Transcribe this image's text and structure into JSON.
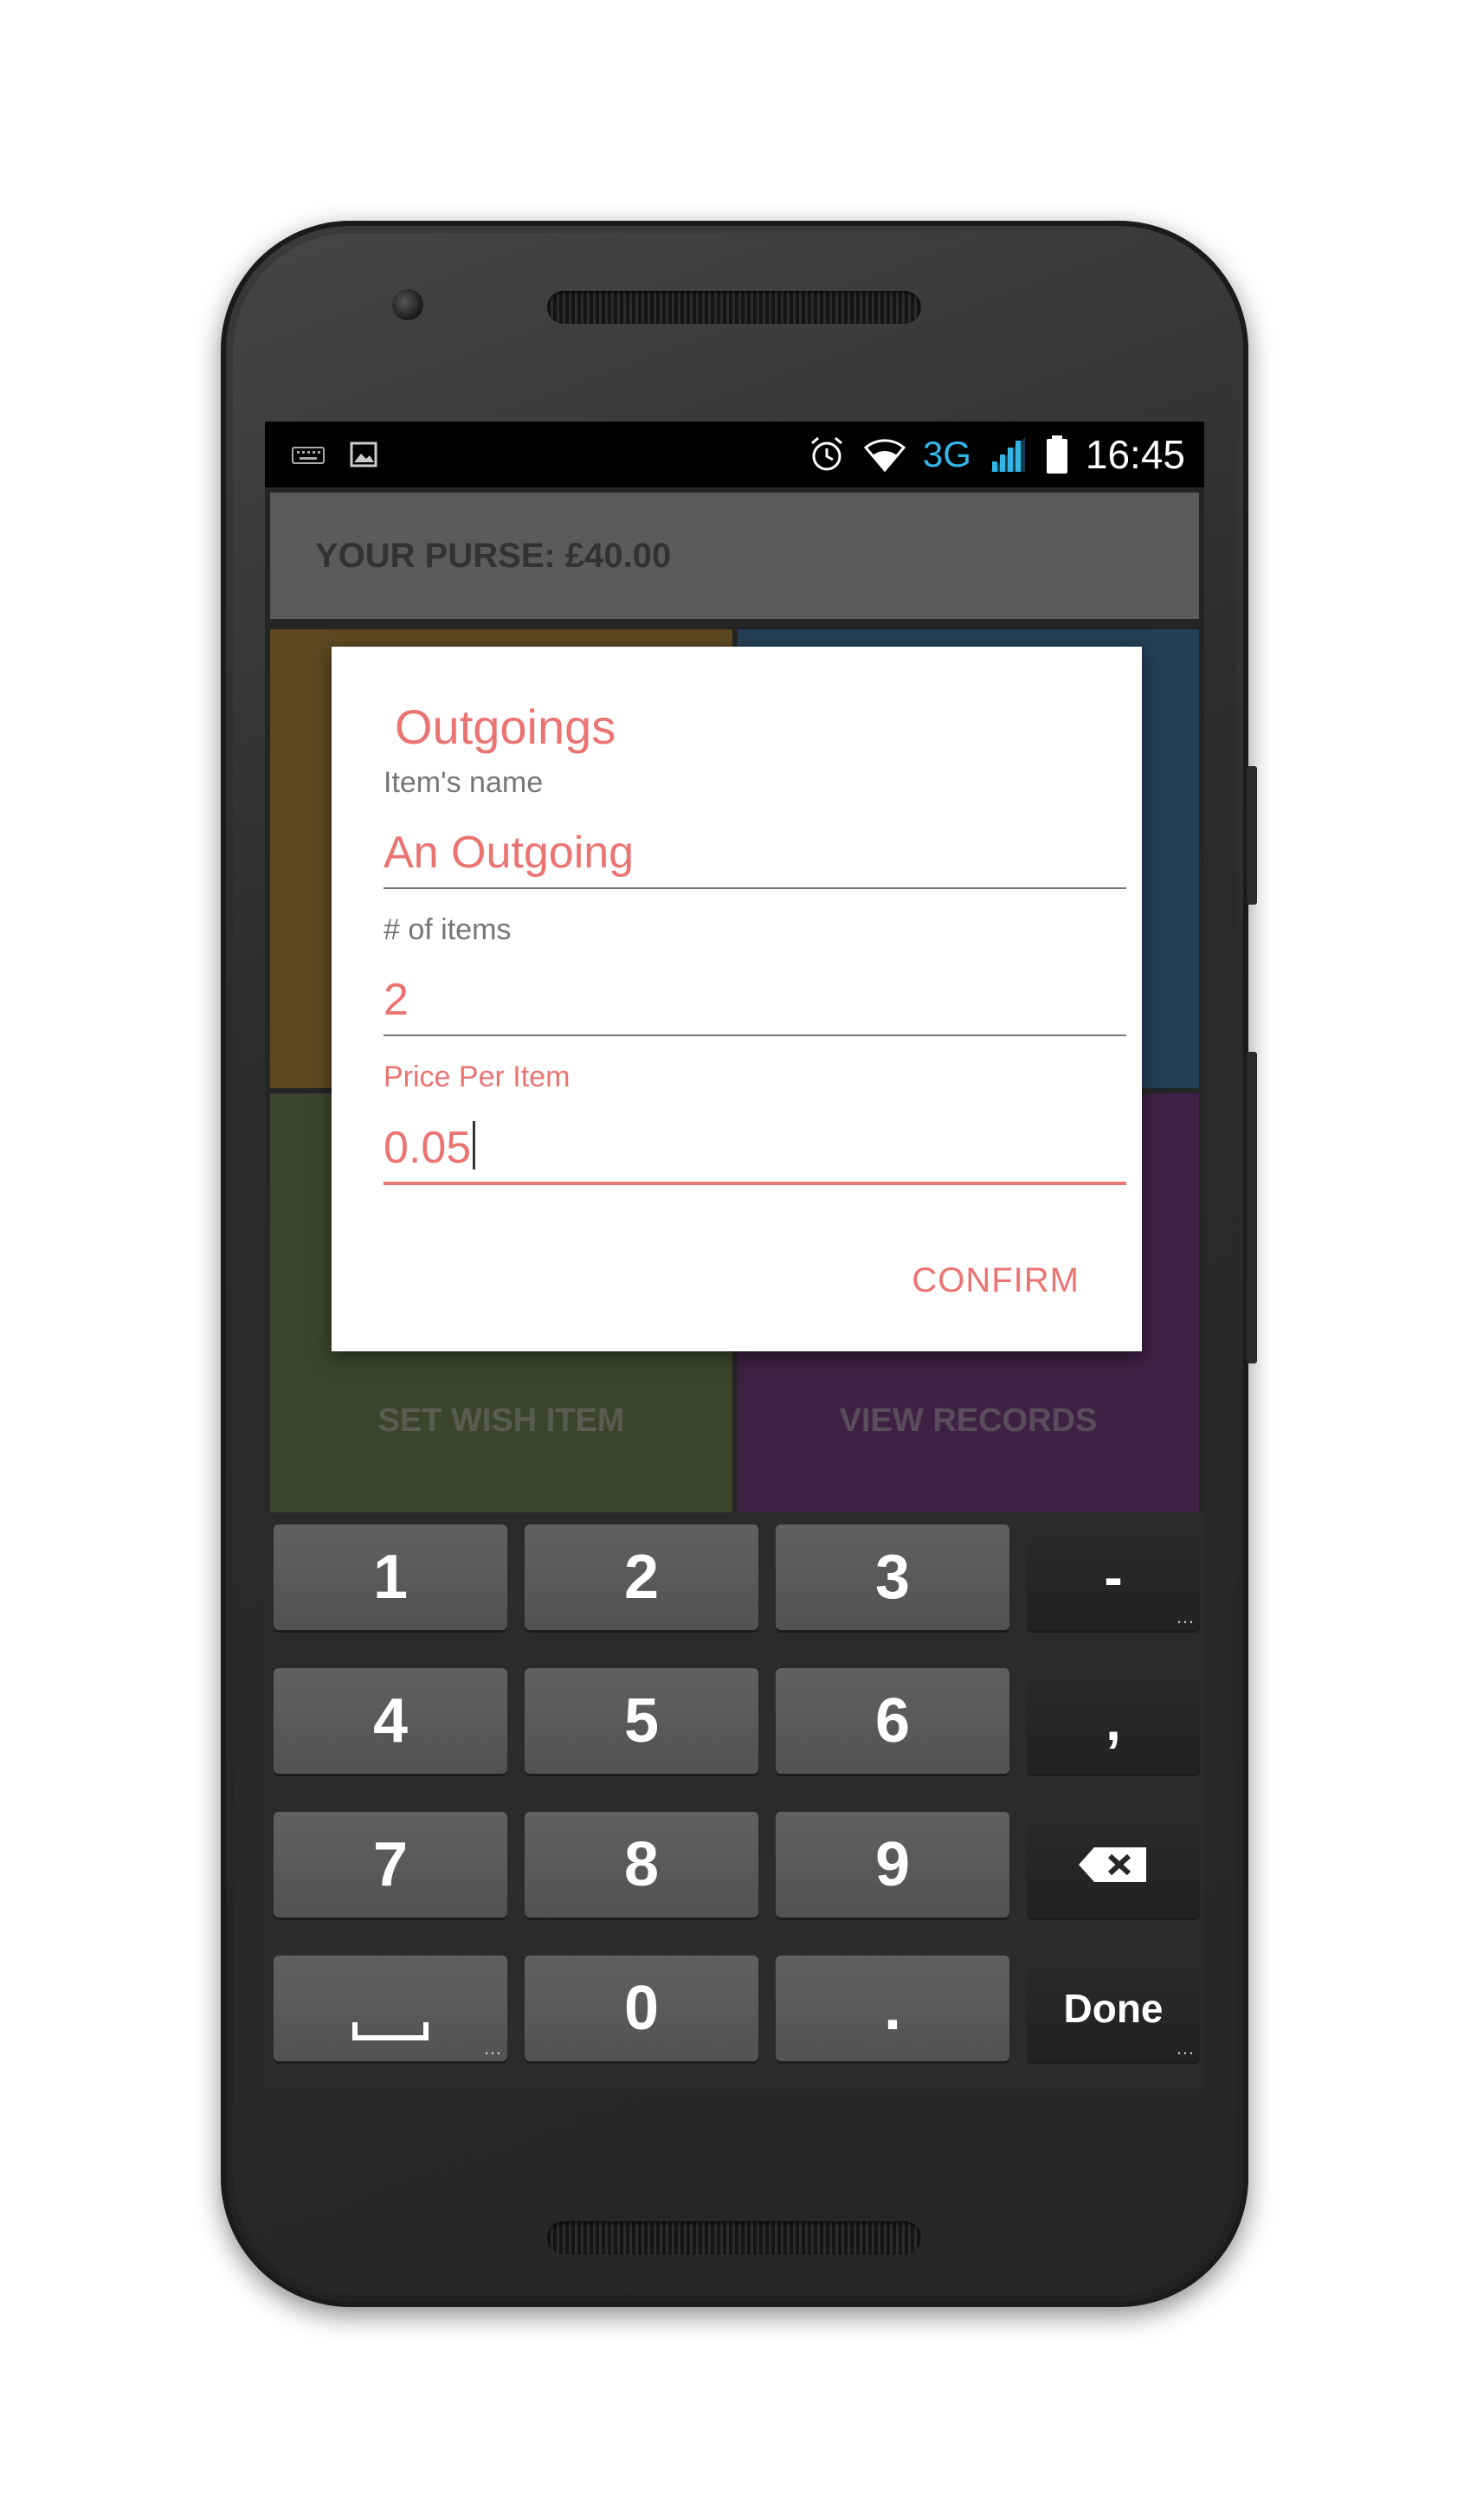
{
  "statusbar": {
    "network": "3G",
    "time": "16:45"
  },
  "app": {
    "purse_label": "YOUR PURSE: £40.00",
    "tiles": [
      {
        "color": "#6f5a2a"
      },
      {
        "color": "#2c4d69"
      },
      {
        "color": "#4a5535",
        "label": "SET WISH ITEM"
      },
      {
        "color": "#4c2a52",
        "label": "VIEW RECORDS"
      }
    ]
  },
  "dialog": {
    "title": "Outgoings",
    "fields": [
      {
        "label": "Item's name",
        "value": "An Outgoing"
      },
      {
        "label": "# of items",
        "value": "2"
      },
      {
        "label": "Price Per Item",
        "value": "0.05"
      }
    ],
    "confirm_label": "CONFIRM"
  },
  "keyboard": {
    "rows": [
      [
        "1",
        "2",
        "3",
        "-"
      ],
      [
        "4",
        "5",
        "6",
        ","
      ],
      [
        "7",
        "8",
        "9",
        "backspace"
      ],
      [
        "space",
        "0",
        ".",
        "Done"
      ]
    ],
    "done_label": "Done"
  },
  "colors": {
    "accent": "#ea7472",
    "dialog_bg": "#ffffff",
    "key_bg": "#5a5a5a",
    "fn_key_bg": "#262626"
  }
}
